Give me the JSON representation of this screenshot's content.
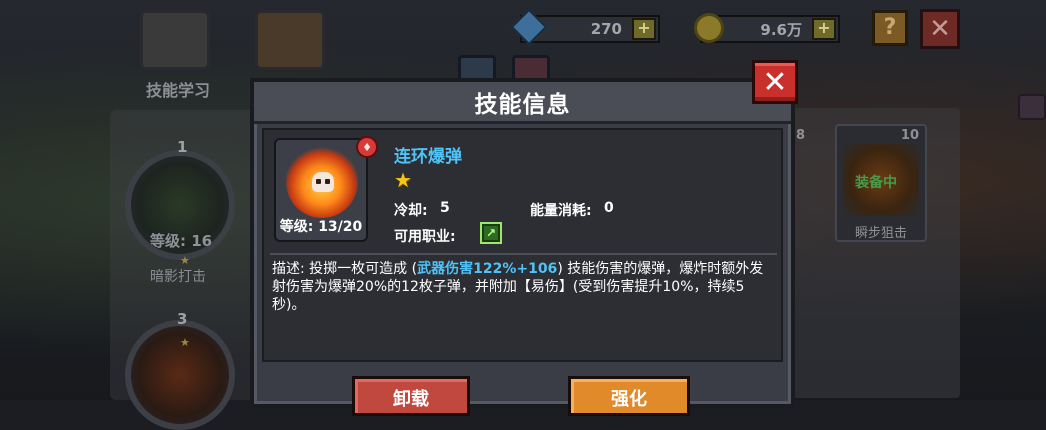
{
  "background": {
    "learn_label": "技能学习",
    "currency_gem": "270",
    "currency_coin": "9.6万",
    "plus": "+",
    "help": "?",
    "close": "✕",
    "skill_nodes": [
      {
        "number": "1",
        "level": "等级: 16",
        "name": "暗影打击"
      },
      {
        "number": "3"
      }
    ],
    "right_card": {
      "number": "10",
      "status": "装备中",
      "name": "瞬步狙击"
    },
    "right_card_number_left": "8"
  },
  "modal": {
    "title": "技能信息",
    "close_icon": "✕",
    "skill": {
      "name": "连环爆弹",
      "level": "等级: 13/20",
      "stars": "★",
      "fire_badge_icon": "fire-badge-icon",
      "cooldown_label": "冷却:",
      "cooldown_value": "5",
      "energy_label": "能量消耗:",
      "energy_value": "0",
      "job_label": "可用职业:",
      "job_icon": "bow-class-icon"
    },
    "description": {
      "prefix": "描述: 投掷一枚可造成 (",
      "highlight": "武器伤害122%+106",
      "suffix": ") 技能伤害的爆弹，爆炸时额外发射伤害为爆弹20%的12枚子弹，并附加【易伤】(受到伤害提升10%，持续5秒)。"
    },
    "buttons": {
      "unequip": "卸载",
      "upgrade": "强化"
    }
  },
  "colors": {
    "accent_blue": "#4fc3f7",
    "star_gold": "#f5c518",
    "close_red": "#c9302c",
    "unequip_red": "#c0483e",
    "upgrade_orange": "#e08a2a"
  }
}
